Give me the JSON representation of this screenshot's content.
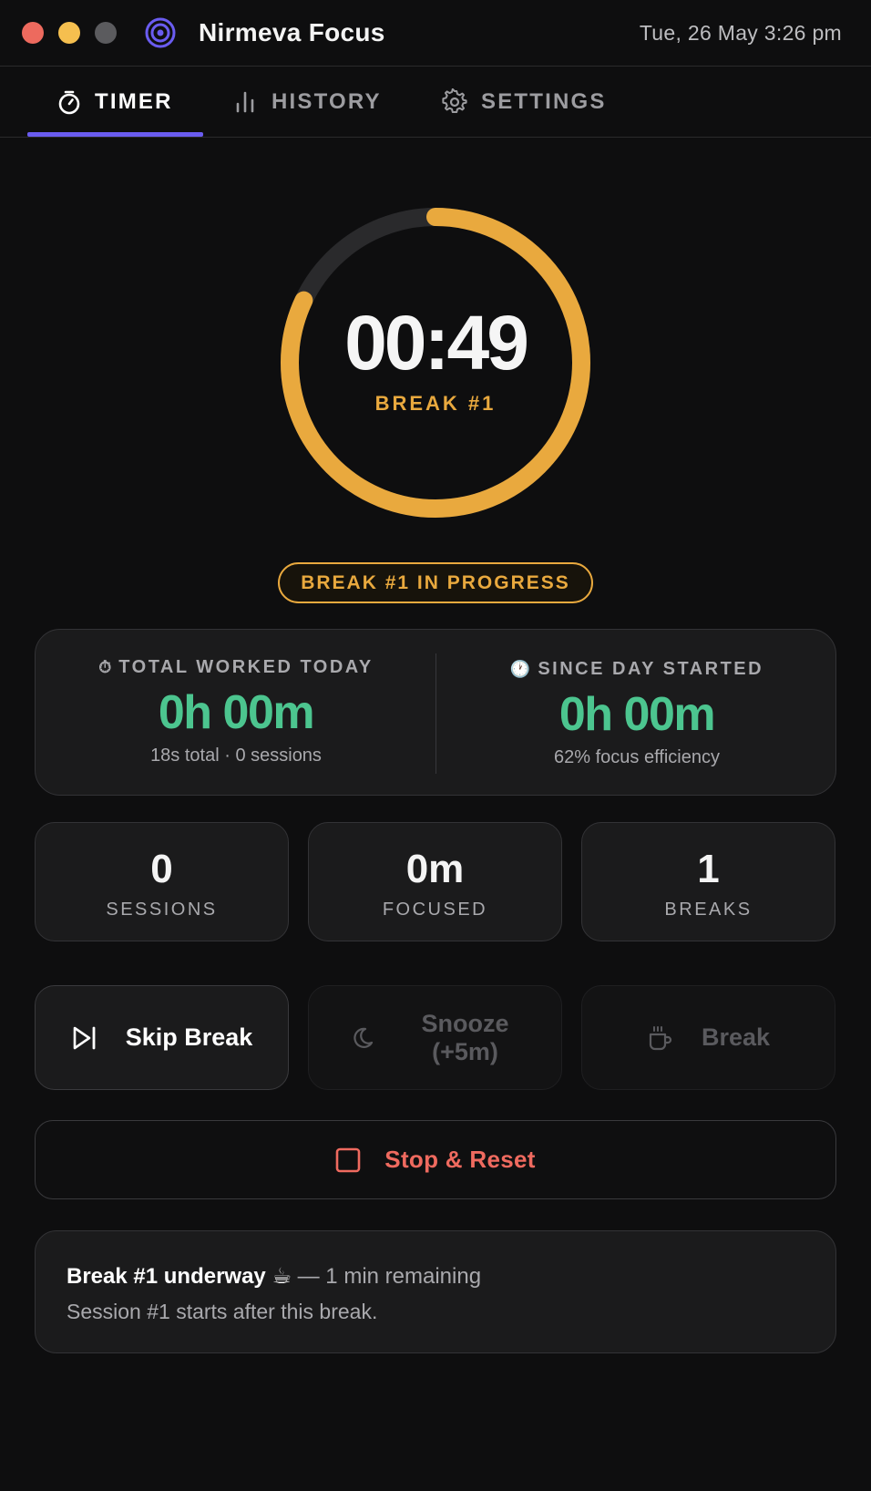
{
  "window": {
    "title": "Nirmeva Focus",
    "datetime": "Tue, 26 May 3:26 pm"
  },
  "tabs": [
    {
      "label": "TIMER",
      "icon": "stopwatch-icon",
      "active": true
    },
    {
      "label": "HISTORY",
      "icon": "bar-chart-icon",
      "active": false
    },
    {
      "label": "SETTINGS",
      "icon": "gear-icon",
      "active": false
    }
  ],
  "timer": {
    "time": "00:49",
    "phase": "BREAK #1",
    "progress_fraction": 0.82,
    "ring_color": "#e9a93e",
    "track_color": "#2a2a2c"
  },
  "status": {
    "text": "BREAK #1 IN PROGRESS"
  },
  "summary": {
    "left": {
      "icon": "⏱",
      "heading": "TOTAL WORKED TODAY",
      "value": "0h 00m",
      "sub": "18s total · 0 sessions"
    },
    "right": {
      "icon": "🕐",
      "heading": "SINCE DAY STARTED",
      "value": "0h 00m",
      "sub": "62% focus efficiency"
    }
  },
  "stats": [
    {
      "value": "0",
      "label": "SESSIONS"
    },
    {
      "value": "0m",
      "label": "FOCUSED"
    },
    {
      "value": "1",
      "label": "BREAKS"
    }
  ],
  "actions": {
    "skip": "Skip Break",
    "snooze": "Snooze (+5m)",
    "break": "Break",
    "stop": "Stop & Reset"
  },
  "info": {
    "headline": "Break #1 underway ☕",
    "remaining": " — 1 min remaining",
    "detail": "Session #1 starts after this break."
  },
  "colors": {
    "accent": "#6a5cf0",
    "break": "#e9a93e",
    "success": "#4cc58f",
    "danger": "#ef6a5f"
  }
}
